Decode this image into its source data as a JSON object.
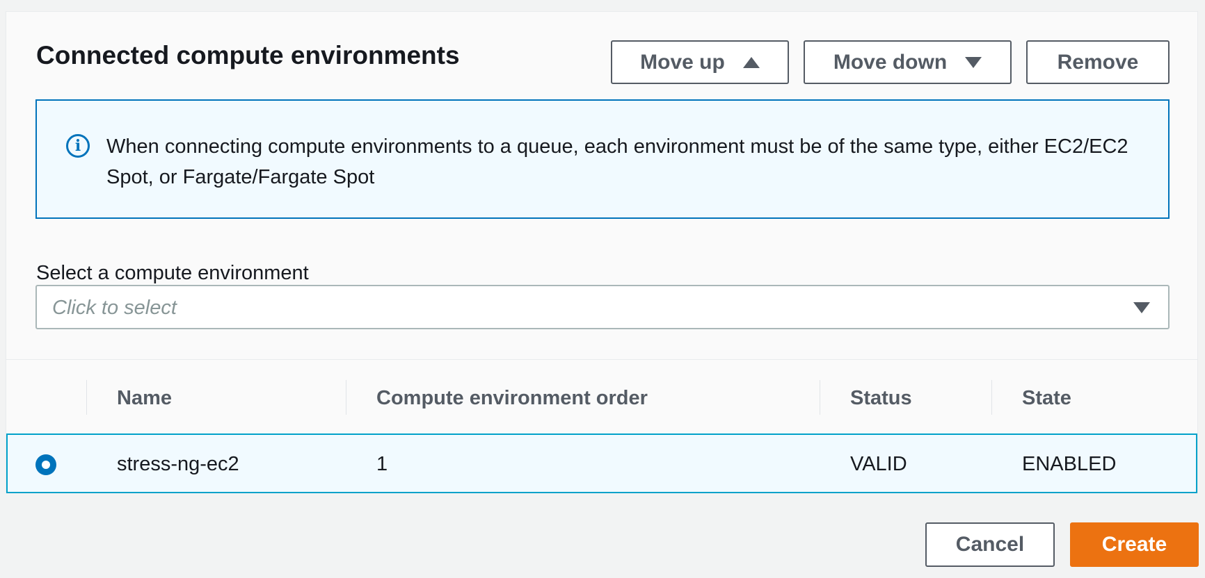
{
  "section": {
    "title": "Connected compute environments",
    "buttons": {
      "move_up": "Move up",
      "move_down": "Move down",
      "remove": "Remove"
    }
  },
  "info": {
    "icon": "info-icon",
    "text": "When connecting compute environments to a queue, each environment must be of the same type, either EC2/EC2 Spot, or Fargate/Fargate Spot"
  },
  "select": {
    "label": "Select a compute environment",
    "placeholder": "Click to select"
  },
  "table": {
    "columns": [
      "Name",
      "Compute environment order",
      "Status",
      "State"
    ],
    "rows": [
      {
        "selected": true,
        "name": "stress-ng-ec2",
        "order": "1",
        "status": "VALID",
        "state": "ENABLED"
      }
    ]
  },
  "footer": {
    "cancel": "Cancel",
    "create": "Create"
  },
  "colors": {
    "accent": "#0073bb",
    "primary_button": "#ec7211",
    "info_background": "#f1faff"
  }
}
